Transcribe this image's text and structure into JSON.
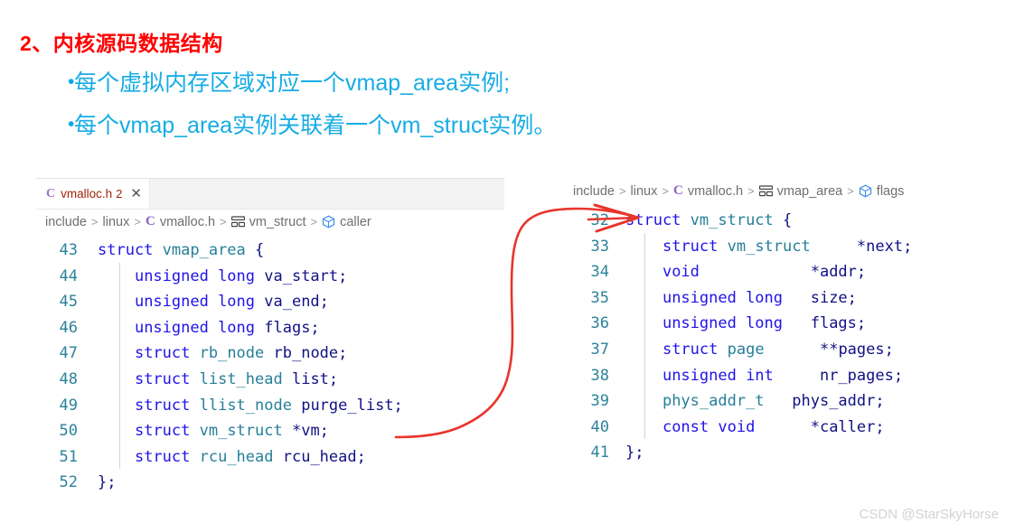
{
  "slide": {
    "heading": "2、内核源码数据结构",
    "heading_color": "#ff0000",
    "bullet_color": "#17ace4",
    "bullets": [
      {
        "marker": "•",
        "text": "每个虚拟内存区域对应一个vmap_area实例;"
      },
      {
        "marker": "•",
        "text": "每个vmap_area实例关联着一个vm_struct实例。"
      }
    ]
  },
  "left_editor": {
    "tab": {
      "filetype_icon": "c-file-icon",
      "filetype_letter": "C",
      "label": "vmalloc.h",
      "badge": "2",
      "close_icon": "✕"
    },
    "breadcrumb": [
      {
        "label": "include",
        "icon": null
      },
      {
        "label": "linux",
        "icon": null
      },
      {
        "label": "vmalloc.h",
        "icon": "c-file-icon",
        "icon_letter": "C"
      },
      {
        "label": "vm_struct",
        "icon": "struct-symbol-icon"
      },
      {
        "label": "caller",
        "icon": "field-symbol-icon"
      }
    ],
    "separator": ">",
    "lines": [
      {
        "number": "43",
        "tokens": [
          {
            "t": "struct ",
            "c": "kw"
          },
          {
            "t": "vmap_area",
            "c": "typ"
          },
          {
            "t": " {",
            "c": "id"
          }
        ]
      },
      {
        "number": "44",
        "tokens": [
          {
            "t": "    ",
            "c": "id"
          },
          {
            "t": "unsigned long",
            "c": "kw"
          },
          {
            "t": " va_start;",
            "c": "id"
          }
        ]
      },
      {
        "number": "45",
        "tokens": [
          {
            "t": "    ",
            "c": "id"
          },
          {
            "t": "unsigned long",
            "c": "kw"
          },
          {
            "t": " va_end;",
            "c": "id"
          }
        ]
      },
      {
        "number": "46",
        "tokens": [
          {
            "t": "    ",
            "c": "id"
          },
          {
            "t": "unsigned long",
            "c": "kw"
          },
          {
            "t": " flags;",
            "c": "id"
          }
        ]
      },
      {
        "number": "47",
        "tokens": [
          {
            "t": "    ",
            "c": "id"
          },
          {
            "t": "struct ",
            "c": "kw"
          },
          {
            "t": "rb_node",
            "c": "typ"
          },
          {
            "t": " rb_node;",
            "c": "id"
          }
        ]
      },
      {
        "number": "48",
        "tokens": [
          {
            "t": "    ",
            "c": "id"
          },
          {
            "t": "struct ",
            "c": "kw"
          },
          {
            "t": "list_head",
            "c": "typ"
          },
          {
            "t": " list;",
            "c": "id"
          }
        ]
      },
      {
        "number": "49",
        "tokens": [
          {
            "t": "    ",
            "c": "id"
          },
          {
            "t": "struct ",
            "c": "kw"
          },
          {
            "t": "llist_node",
            "c": "typ"
          },
          {
            "t": " purge_list;",
            "c": "id"
          }
        ]
      },
      {
        "number": "50",
        "tokens": [
          {
            "t": "    ",
            "c": "id"
          },
          {
            "t": "struct ",
            "c": "kw"
          },
          {
            "t": "vm_struct",
            "c": "typ"
          },
          {
            "t": " *vm;",
            "c": "id"
          }
        ]
      },
      {
        "number": "51",
        "tokens": [
          {
            "t": "    ",
            "c": "id"
          },
          {
            "t": "struct ",
            "c": "kw"
          },
          {
            "t": "rcu_head",
            "c": "typ"
          },
          {
            "t": " rcu_head;",
            "c": "id"
          }
        ]
      },
      {
        "number": "52",
        "tokens": [
          {
            "t": "};",
            "c": "id"
          }
        ]
      }
    ]
  },
  "right_editor": {
    "breadcrumb": [
      {
        "label": "include",
        "icon": null
      },
      {
        "label": "linux",
        "icon": null
      },
      {
        "label": "vmalloc.h",
        "icon": "c-file-icon",
        "icon_letter": "C"
      },
      {
        "label": "vmap_area",
        "icon": "struct-symbol-icon"
      },
      {
        "label": "flags",
        "icon": "field-symbol-icon"
      }
    ],
    "separator": ">",
    "lines": [
      {
        "number": "32",
        "tokens": [
          {
            "t": "struct ",
            "c": "kw"
          },
          {
            "t": "vm_struct",
            "c": "typ"
          },
          {
            "t": " {",
            "c": "id"
          }
        ]
      },
      {
        "number": "33",
        "tokens": [
          {
            "t": "    ",
            "c": "id"
          },
          {
            "t": "struct ",
            "c": "kw"
          },
          {
            "t": "vm_struct",
            "c": "typ"
          },
          {
            "t": "     *next;",
            "c": "id"
          }
        ]
      },
      {
        "number": "34",
        "tokens": [
          {
            "t": "    ",
            "c": "id"
          },
          {
            "t": "void",
            "c": "kw"
          },
          {
            "t": "            *addr;",
            "c": "id"
          }
        ]
      },
      {
        "number": "35",
        "tokens": [
          {
            "t": "    ",
            "c": "id"
          },
          {
            "t": "unsigned long",
            "c": "kw"
          },
          {
            "t": "   size;",
            "c": "id"
          }
        ]
      },
      {
        "number": "36",
        "tokens": [
          {
            "t": "    ",
            "c": "id"
          },
          {
            "t": "unsigned long",
            "c": "kw"
          },
          {
            "t": "   flags;",
            "c": "id"
          }
        ]
      },
      {
        "number": "37",
        "tokens": [
          {
            "t": "    ",
            "c": "id"
          },
          {
            "t": "struct ",
            "c": "kw"
          },
          {
            "t": "page",
            "c": "typ"
          },
          {
            "t": "      **pages;",
            "c": "id"
          }
        ]
      },
      {
        "number": "38",
        "tokens": [
          {
            "t": "    ",
            "c": "id"
          },
          {
            "t": "unsigned int",
            "c": "kw"
          },
          {
            "t": "     nr_pages;",
            "c": "id"
          }
        ]
      },
      {
        "number": "39",
        "tokens": [
          {
            "t": "    ",
            "c": "id"
          },
          {
            "t": "phys_addr_t",
            "c": "typ"
          },
          {
            "t": "   phys_addr;",
            "c": "id"
          }
        ]
      },
      {
        "number": "40",
        "tokens": [
          {
            "t": "    ",
            "c": "id"
          },
          {
            "t": "const void",
            "c": "kw"
          },
          {
            "t": "      *caller;",
            "c": "id"
          }
        ]
      },
      {
        "number": "41",
        "tokens": [
          {
            "t": "};",
            "c": "id"
          }
        ]
      }
    ]
  },
  "annotation": {
    "name": "red-link-arrow",
    "color": "#e8352c",
    "description": "arrow from struct vmap_area *vm field to struct vm_struct definition"
  },
  "watermark": {
    "text": "CSDN @StarSkyHorse"
  },
  "top_strip": {
    "text": "··· ··· ··· ··· ···"
  }
}
